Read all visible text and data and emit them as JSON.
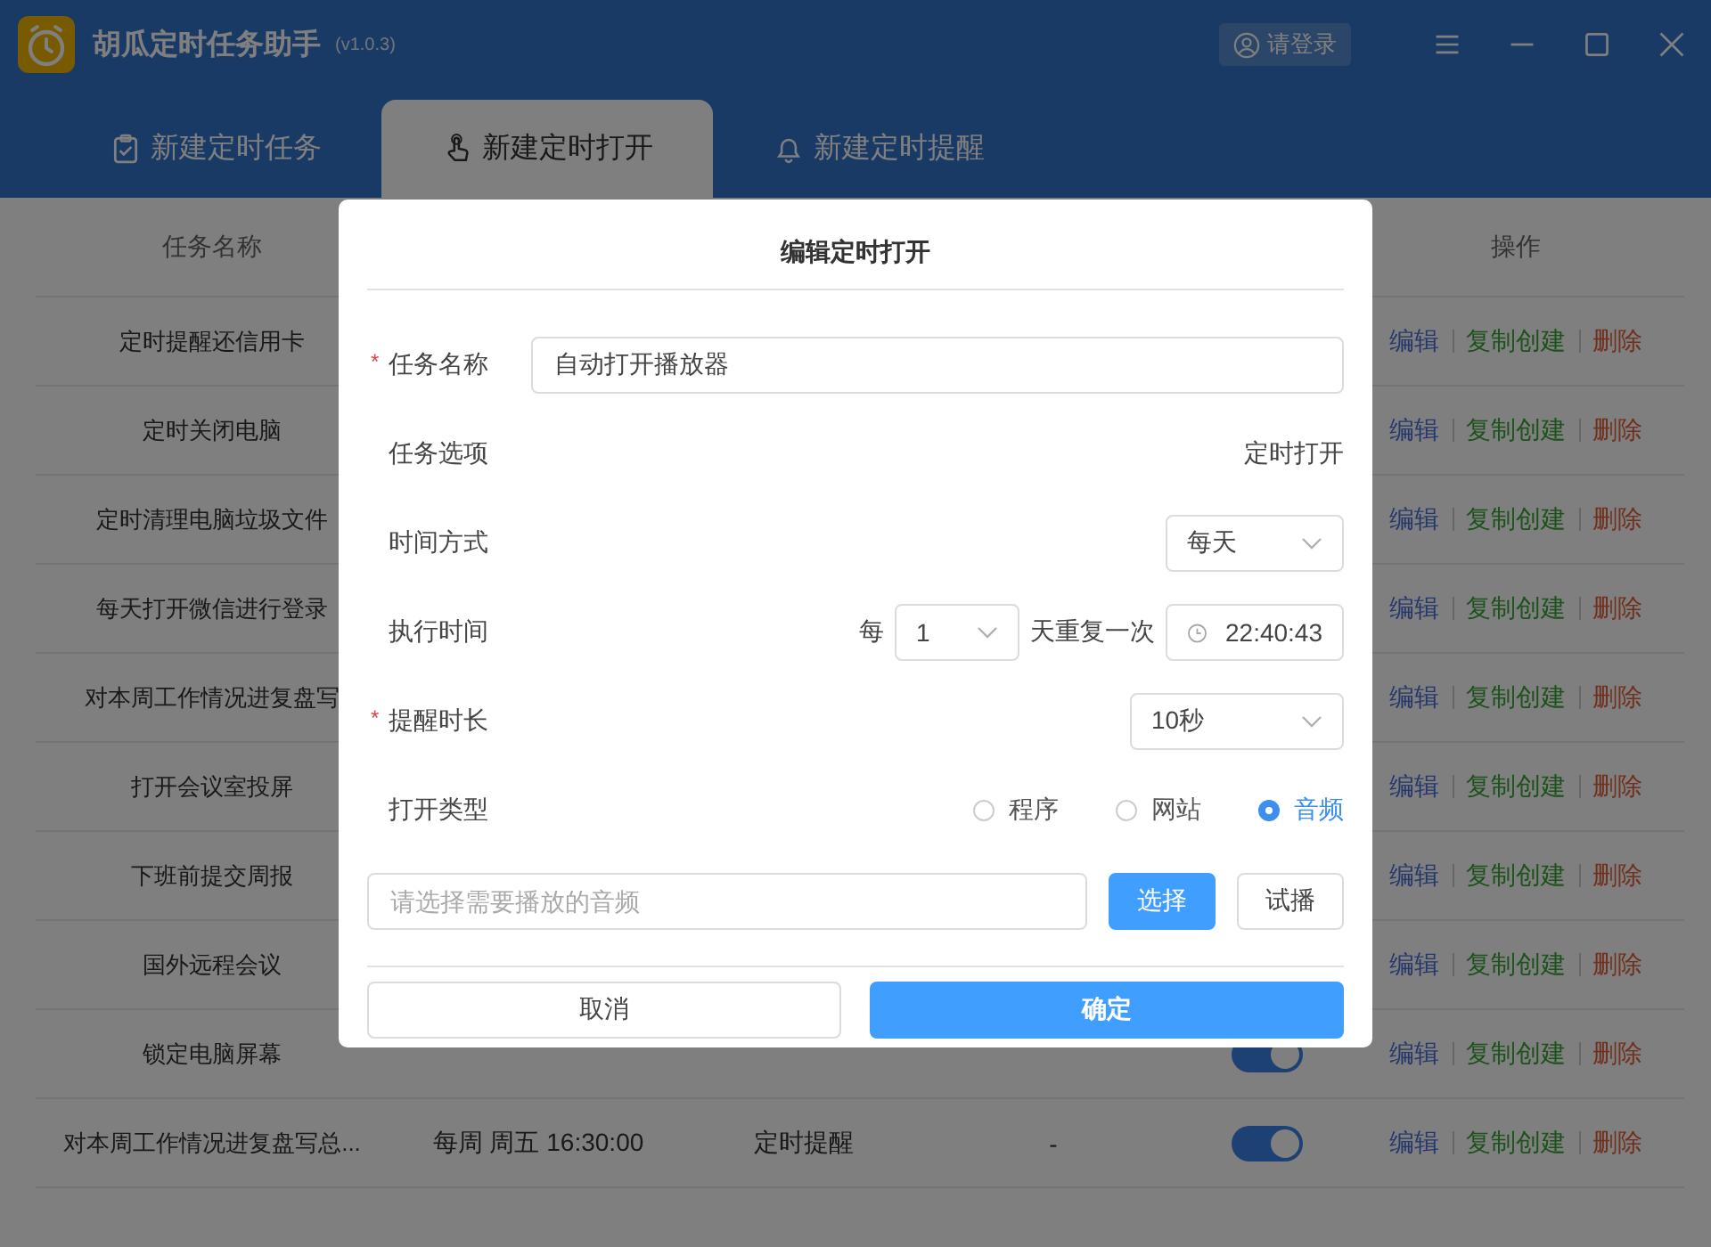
{
  "app": {
    "title": "胡瓜定时任务助手",
    "version": "(v1.0.3)",
    "login": "请登录"
  },
  "tabs": [
    {
      "label": "新建定时任务",
      "selected": false
    },
    {
      "label": "新建定时打开",
      "selected": true
    },
    {
      "label": "新建定时提醒",
      "selected": false
    }
  ],
  "table": {
    "columns": [
      "任务名称",
      "操作"
    ],
    "rows": [
      {
        "name": "定时提醒还信用卡",
        "actions": [
          "编辑",
          "复制创建",
          "删除"
        ]
      },
      {
        "name": "定时关闭电脑",
        "actions": [
          "编辑",
          "复制创建",
          "删除"
        ]
      },
      {
        "name": "定时清理电脑垃圾文件",
        "actions": [
          "编辑",
          "复制创建",
          "删除"
        ]
      },
      {
        "name": "每天打开微信进行登录",
        "actions": [
          "编辑",
          "复制创建",
          "删除"
        ]
      },
      {
        "name": "对本周工作情况进复盘写",
        "actions": [
          "编辑",
          "复制创建",
          "删除"
        ]
      },
      {
        "name": "打开会议室投屏",
        "actions": [
          "编辑",
          "复制创建",
          "删除"
        ]
      },
      {
        "name": "下班前提交周报",
        "actions": [
          "编辑",
          "复制创建",
          "删除"
        ]
      },
      {
        "name": "国外远程会议",
        "actions": [
          "编辑",
          "复制创建",
          "删除"
        ]
      },
      {
        "name": "锁定电脑屏幕",
        "on": true,
        "actions": [
          "编辑",
          "复制创建",
          "删除"
        ]
      },
      {
        "name": "对本周工作情况进复盘写总...",
        "schedule": "每周 周五 16:30:00",
        "type": "定时提醒",
        "column_4": "-",
        "on": true,
        "actions": [
          "编辑",
          "复制创建",
          "删除"
        ]
      }
    ]
  },
  "dialog": {
    "title": "编辑定时打开",
    "fields": [
      {
        "kind": "text",
        "required_mark": "*",
        "label": "任务名称",
        "value": "自动打开播放器"
      },
      {
        "kind": "static",
        "label": "任务选项",
        "value": "定时打开"
      },
      {
        "kind": "select",
        "label": "时间方式",
        "value": "每天"
      },
      {
        "kind": "repeat",
        "label": "执行时间",
        "prefix": "每",
        "count": "1",
        "suffix": "天重复一次",
        "time": "22:40:43"
      },
      {
        "kind": "select",
        "required_mark": "*",
        "label": "提醒时长",
        "value": "10秒"
      },
      {
        "kind": "radio",
        "label": "打开类型",
        "options": [
          {
            "label": "程序",
            "selected": false
          },
          {
            "label": "网站",
            "selected": false
          },
          {
            "label": "音频",
            "selected": true
          }
        ]
      }
    ],
    "file": {
      "placeholder": "请选择需要播放的音频",
      "choose": "选择",
      "preview": "试播"
    },
    "cancel": "取消",
    "ok": "确定"
  }
}
